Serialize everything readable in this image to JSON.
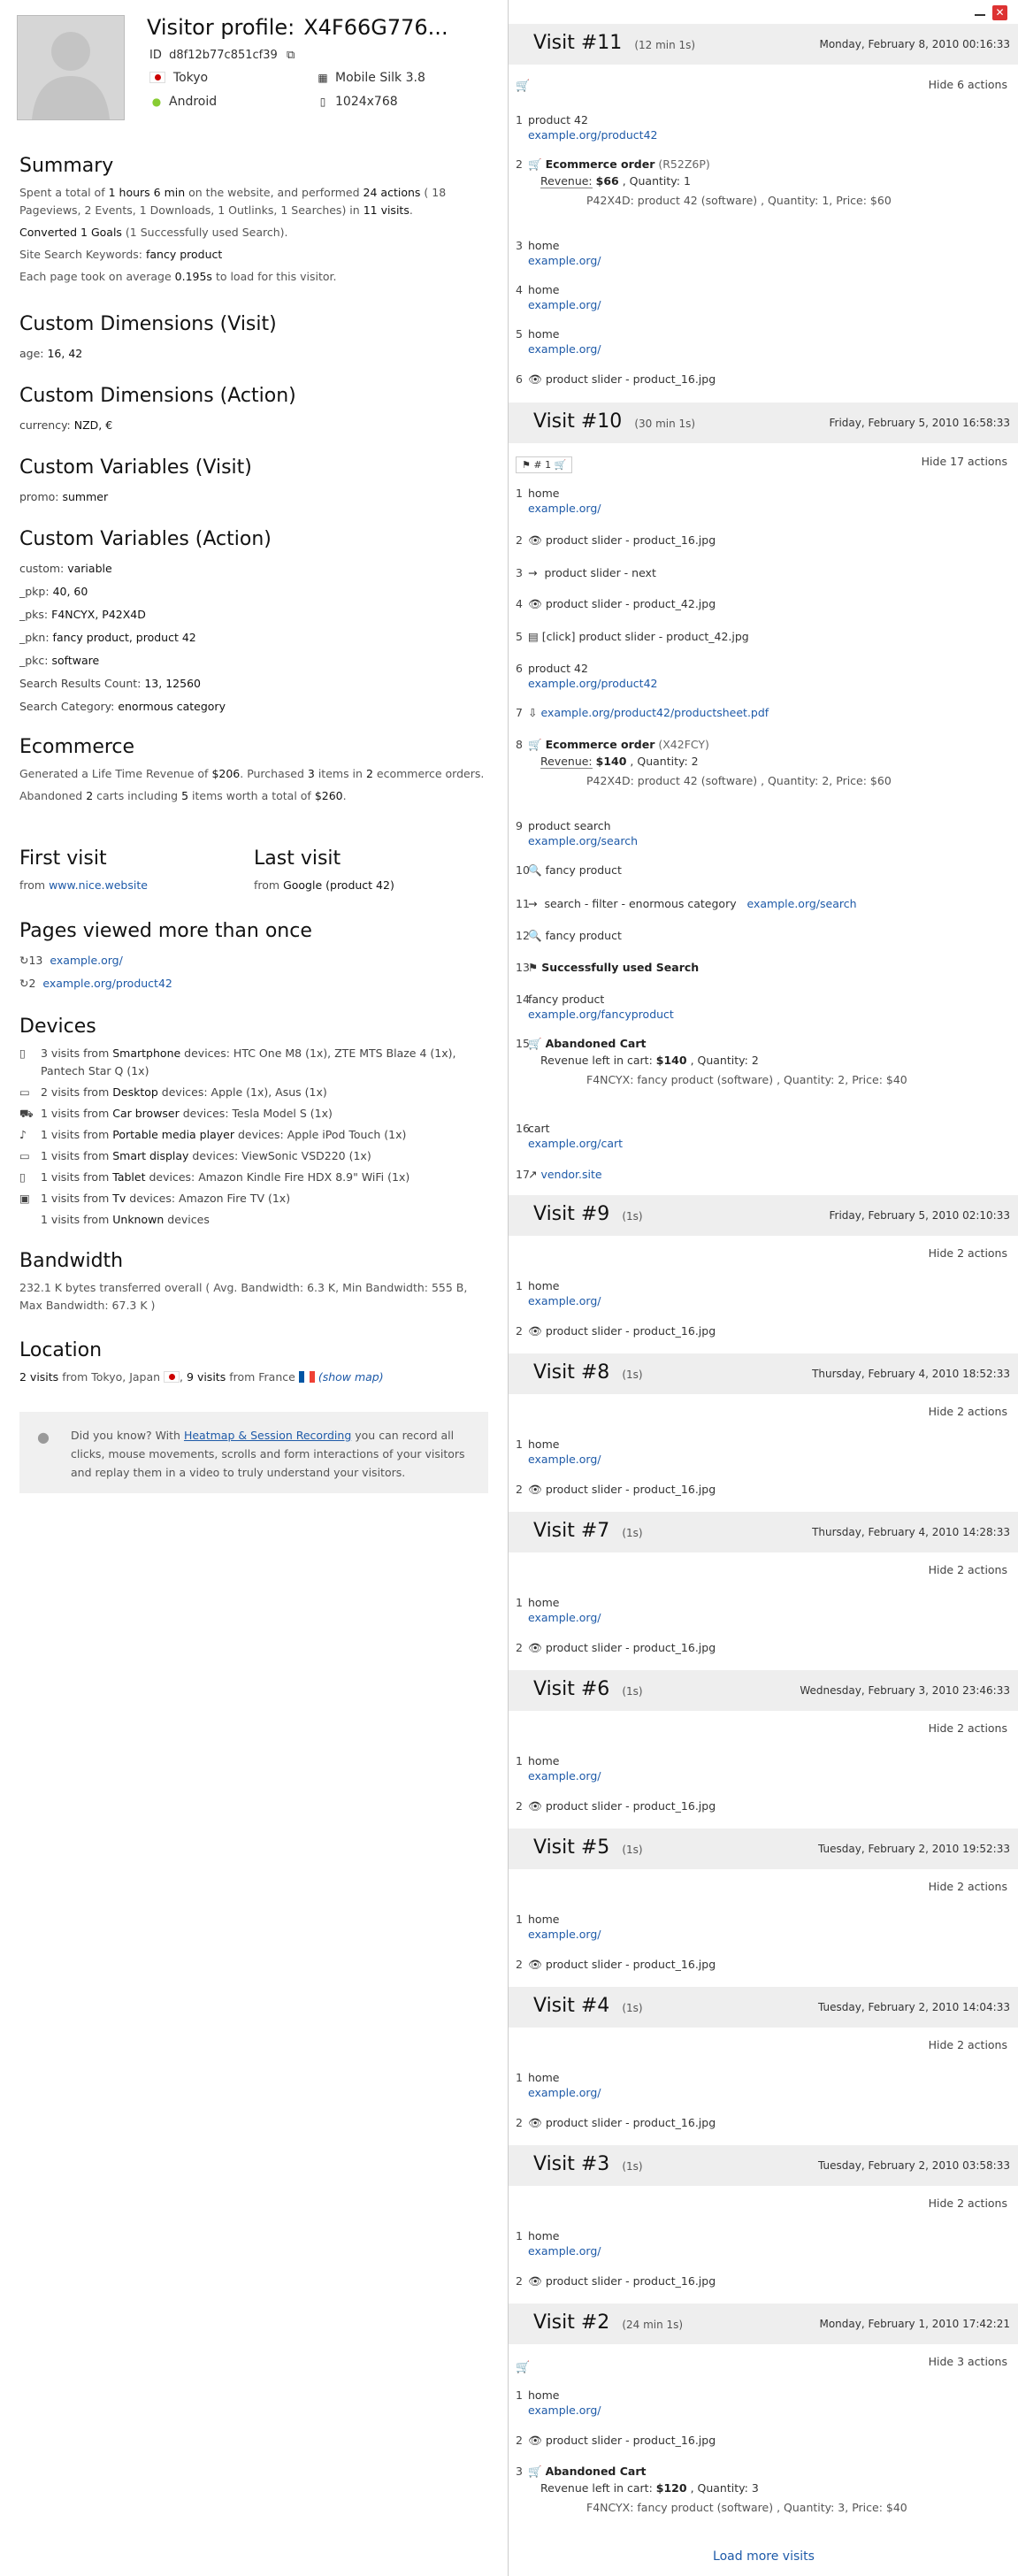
{
  "profile": {
    "title": "Visitor profile:",
    "visitor_id": "X4F66G776...",
    "id_label": "ID",
    "id_value": "d8f12b77c851cf39",
    "city": "Tokyo",
    "browser": "Mobile Silk 3.8",
    "os": "Android",
    "resolution": "1024x768"
  },
  "summary": {
    "title": "Summary",
    "l1a": "Spent a total of",
    "l1b": "1 hours 6 min",
    "l1c": "on the website, and performed",
    "l1d": "24 actions",
    "l1e": "( 18 Pageviews, 2 Events, 1 Downloads, 1 Outlinks, 1 Searches) in",
    "l1f": "11 visits",
    "l2a": "Converted 1 Goals",
    "l2b": "(1 Successfully used Search).",
    "l3a": "Site Search Keywords:",
    "l3b": "fancy product",
    "l4a": "Each page took on average",
    "l4b": "0.195s",
    "l4c": "to load for this visitor."
  },
  "cdv": {
    "title": "Custom Dimensions (Visit)",
    "k": "age:",
    "v": "16, 42"
  },
  "cda": {
    "title": "Custom Dimensions (Action)",
    "k": "currency:",
    "v": "NZD, €"
  },
  "cvv": {
    "title": "Custom Variables (Visit)",
    "k": "promo:",
    "v": "summer"
  },
  "cva": {
    "title": "Custom Variables (Action)",
    "rows": [
      {
        "k": "custom:",
        "v": "variable"
      },
      {
        "k": "_pkp:",
        "v": "40, 60"
      },
      {
        "k": "_pks:",
        "v": "F4NCYX, P42X4D"
      },
      {
        "k": "_pkn:",
        "v": "fancy product, product 42"
      },
      {
        "k": "_pkc:",
        "v": "software"
      },
      {
        "k": "Search Results Count:",
        "v": "13, 12560"
      },
      {
        "k": "Search Category:",
        "v": "enormous category"
      }
    ]
  },
  "ecom": {
    "title": "Ecommerce",
    "l1a": "Generated a Life Time Revenue of",
    "l1b": "$206",
    "l1c": ". Purchased",
    "l1d": "3",
    "l1e": "items in",
    "l1f": "2",
    "l1g": "ecommerce orders.",
    "l2a": "Abandoned",
    "l2b": "2",
    "l2c": "carts including",
    "l2d": "5",
    "l2e": "items worth a total of",
    "l2f": "$260",
    "l2g": "."
  },
  "first": {
    "title": "First visit",
    "from": "from",
    "link": "www.nice.website"
  },
  "last": {
    "title": "Last visit",
    "from": "from",
    "link": "Google (product 42)"
  },
  "pages": {
    "title": "Pages viewed more than once",
    "items": [
      {
        "count": "13",
        "url": "example.org/"
      },
      {
        "count": "2",
        "url": "example.org/product42"
      }
    ]
  },
  "devices": {
    "title": "Devices",
    "items": [
      {
        "icon": "smartphone-icon",
        "glyph": "▯",
        "a": "3 visits from",
        "b": "Smartphone",
        "c": "devices: HTC One M8 (1x), ZTE MTS Blaze 4 (1x),",
        "d": "Pantech Star Q (1x)"
      },
      {
        "icon": "desktop-icon",
        "glyph": "▭",
        "a": "2 visits from",
        "b": "Desktop",
        "c": "devices: Apple (1x), Asus (1x)",
        "d": ""
      },
      {
        "icon": "car-icon",
        "glyph": "⛟",
        "a": "1 visits from",
        "b": "Car browser",
        "c": "devices: Tesla Model S (1x)",
        "d": ""
      },
      {
        "icon": "music-icon",
        "glyph": "♪",
        "a": "1 visits from",
        "b": "Portable media player",
        "c": "devices: Apple iPod Touch (1x)",
        "d": ""
      },
      {
        "icon": "display-icon",
        "glyph": "▭",
        "a": "1 visits from",
        "b": "Smart display",
        "c": "devices: ViewSonic VSD220 (1x)",
        "d": ""
      },
      {
        "icon": "tablet-icon",
        "glyph": "▯",
        "a": "1 visits from",
        "b": "Tablet",
        "c": "devices: Amazon Kindle Fire HDX 8.9\" WiFi (1x)",
        "d": ""
      },
      {
        "icon": "tv-icon",
        "glyph": "▣",
        "a": "1 visits from",
        "b": "Tv",
        "c": "devices: Amazon Fire TV (1x)",
        "d": ""
      },
      {
        "icon": "unknown-icon",
        "glyph": "",
        "a": "1 visits from",
        "b": "Unknown",
        "c": "devices",
        "d": ""
      }
    ]
  },
  "bandwidth": {
    "title": "Bandwidth",
    "l1": "232.1 K bytes transferred overall ( Avg. Bandwidth: 6.3 K, Min Bandwidth: 555 B,",
    "l2": "Max Bandwidth: 67.3 K )"
  },
  "location": {
    "title": "Location",
    "a": "2 visits",
    "b": "from Tokyo, Japan",
    "c": ",",
    "d": "9 visits",
    "e": "from France",
    "f": "(show map)"
  },
  "tip": {
    "a": "Did you know? With",
    "link": "Heatmap & Session Recording",
    "b": "you can record all clicks, mouse movements, scrolls and form interactions of your visitors and replay them in a video to truly understand your visitors."
  },
  "visits": {
    "v11": {
      "title": "Visit #11",
      "dur": "(12 min 1s)",
      "date": "Monday, February 8, 2010 00:16:33",
      "hide": "Hide 6 actions"
    },
    "v10": {
      "title": "Visit #10",
      "dur": "(30 min 1s)",
      "date": "Friday, February 5, 2010 16:58:33",
      "hide": "Hide 17 actions",
      "goal": "# 1"
    },
    "v9": {
      "title": "Visit #9",
      "dur": "(1s)",
      "date": "Friday, February 5, 2010 02:10:33",
      "hide": "Hide 2 actions"
    },
    "v8": {
      "title": "Visit #8",
      "dur": "(1s)",
      "date": "Thursday, February 4, 2010 18:52:33",
      "hide": "Hide 2 actions"
    },
    "v7": {
      "title": "Visit #7",
      "dur": "(1s)",
      "date": "Thursday, February 4, 2010 14:28:33",
      "hide": "Hide 2 actions"
    },
    "v6": {
      "title": "Visit #6",
      "dur": "(1s)",
      "date": "Wednesday, February 3, 2010 23:46:33",
      "hide": "Hide 2 actions"
    },
    "v5": {
      "title": "Visit #5",
      "dur": "(1s)",
      "date": "Tuesday, February 2, 2010 19:52:33",
      "hide": "Hide 2 actions"
    },
    "v4": {
      "title": "Visit #4",
      "dur": "(1s)",
      "date": "Tuesday, February 2, 2010 14:04:33",
      "hide": "Hide 2 actions"
    },
    "v3": {
      "title": "Visit #3",
      "dur": "(1s)",
      "date": "Tuesday, February 2, 2010 03:58:33",
      "hide": "Hide 2 actions"
    },
    "v2": {
      "title": "Visit #2",
      "dur": "(24 min 1s)",
      "date": "Monday, February 1, 2010 17:42:21",
      "hide": "Hide 3 actions"
    }
  },
  "a": {
    "home": "home",
    "homeurl": "example.org/",
    "slider16": "product slider - product_16.jpg",
    "p42": "product 42",
    "p42url": "example.org/product42",
    "order": "Ecommerce order",
    "rev": "Revenue:",
    "qty": ", Quantity:",
    "orderA": "(R52Z6P)",
    "revA": "$66",
    "qtyA": "1",
    "detA": "P42X4D: product 42 (software) , Quantity: 1, Price: $60",
    "next": "product slider - next",
    "slider42": "product slider - product_42.jpg",
    "click42": "[click] product slider - product_42.jpg",
    "pdf": "example.org/product42/productsheet.pdf",
    "orderB": "(X42FCY)",
    "revB": "$140",
    "qtyB": "2",
    "detB": "P42X4D: product 42 (software) , Quantity: 2, Price: $60",
    "psearch": "product search",
    "searchurl": "example.org/search",
    "fancy": "fancy product",
    "filter": "search - filter - enormous category",
    "goal": "Successfully used Search",
    "fancyurl": "example.org/fancyproduct",
    "cart": "Abandoned Cart",
    "left": "Revenue left in cart:",
    "revC": "$140",
    "qtyC": "2",
    "detC": "F4NCYX: fancy product (software) , Quantity: 2, Price: $40",
    "cartpg": "cart",
    "carturl": "example.org/cart",
    "vendor": "vendor.site",
    "revD": "$120",
    "qtyD": "3",
    "detD": "F4NCYX: fancy product (software) , Quantity: 3, Price: $40"
  },
  "loadmore": "Load more visits"
}
